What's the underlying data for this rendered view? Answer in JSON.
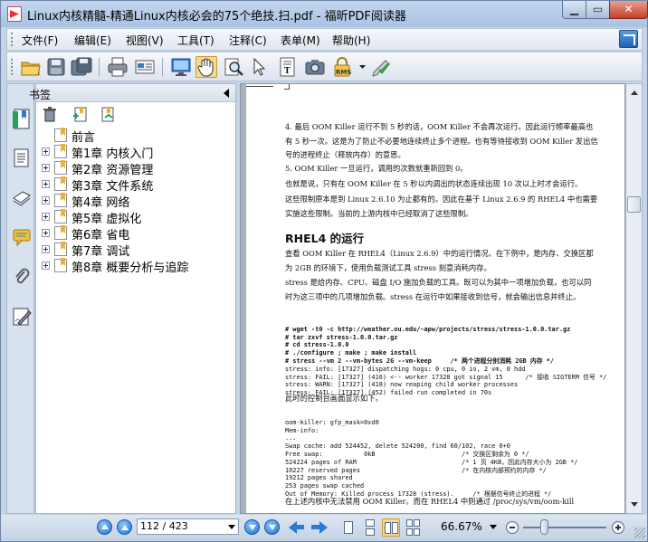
{
  "window": {
    "title": "Linux内核精髓-精通Linux内核必会的75个绝技.扫.pdf - 福昕PDF阅读器",
    "min_label": "▁",
    "max_label": "▭",
    "close_label": "✕"
  },
  "menu": {
    "items": [
      "文件(F)",
      "编辑(E)",
      "视图(V)",
      "工具(T)",
      "注释(C)",
      "表单(M)",
      "帮助(H)"
    ]
  },
  "toolbar": {
    "icons": [
      "open-folder-icon",
      "save-icon",
      "save-as-icon",
      "print-icon",
      "email-icon",
      "fullscreen-icon",
      "hand-icon",
      "zoom-icon",
      "select-icon",
      "typewriter-icon",
      "snapshot-icon",
      "rms-icon",
      "sign-icon"
    ],
    "rms_label": "RMS"
  },
  "bookmarks": {
    "header": "书签",
    "items": [
      {
        "label": "前言",
        "expandable": false
      },
      {
        "label": "第1章 内核入门",
        "expandable": true
      },
      {
        "label": "第2章 资源管理",
        "expandable": true
      },
      {
        "label": "第3章 文件系统",
        "expandable": true
      },
      {
        "label": "第4章 网络",
        "expandable": true
      },
      {
        "label": "第5章 虚拟化",
        "expandable": true
      },
      {
        "label": "第6章 省电",
        "expandable": true
      },
      {
        "label": "第7章 调试",
        "expandable": true
      },
      {
        "label": "第8章 概要分析与追踪",
        "expandable": true
      }
    ]
  },
  "document": {
    "p1": "4. 最后 OOM Killer 运行不到 5 秒的话，OOM Killer 不会再次运行。因此运行频率最高也有 5 秒一次。这是为了防止不必要地连续终止多个进程。也有等待接收到 OOM Killer 发出信号的进程终止（释放内存）的意思。",
    "p2": "5. OOM Killer 一旦运行，调用的次数就重新回到 0。",
    "p3": "也就是说，只有在 OOM Killer 在 5 秒以内调出的状态连续出现 10 次以上时才会运行。",
    "p4": "这些限制原本是到 Linux 2.6.10 为止都有的。因此在基于 Linux 2.6.9 的 RHEL4 中也需要实施这些限制。当前的上游内核中已经取消了这些限制。",
    "heading": "RHEL4 的运行",
    "p5": "查看 OOM Killer 在 RHEL4（Linux 2.6.9）中的运行情况。在下例中，是内存、交换区都为 2GB 的环境下，使用负载测试工具 stress 刻意消耗内存。",
    "p6": "stress 是给内存、CPU、磁盘 I/O 施加负载的工具。既可以为其中一项增加负载，也可以同时为这三项中的几项增加负载。stress 在运行中如果接收到信号，就会输出信息并终止。",
    "code1": [
      "# wget -t0 -c http://weather.ou.edu/~apw/projects/stress/stress-1.0.0.tar.gz",
      "# tar zxvf stress-1.0.0.tar.gz",
      "# cd stress-1.0.0",
      "# ./configure ; make ; make install",
      "# stress --vm 2 --vm-bytes 2G --vm-keep     /* 两个进程分别消耗 2GB 内存 */",
      "stress: info: [17327] dispatching hogs: 0 cpu, 0 io, 2 vm, 0 hdd",
      "stress: FAIL: [17327] (416) <-- worker 17328 got signal 15      /* 接收 SIGTERM 信号 */",
      "stress: WARN: [17327] (418) now reaping child worker processes",
      "stress: FAIL: [17327] (452) failed run completed in 70s"
    ],
    "p7": "此时的控制台画面显示如下。",
    "code2": [
      "oom-killer: gfp_mask=0xd0",
      "Mem-info:",
      "...",
      "Swap cache: add 524452, delete 524200, find 60/102, race 0+0",
      "Free swap:           0kB                       /* 交换区剩余为 0 */",
      "524224 pages of RAM                            /* 1 页 4KB，因此内存大小为 2GB */",
      "10227 reserved pages                           /* 在内核内部预约的内存 */",
      "19212 pages shared",
      "253 pages swap cached",
      "Out of Memory: Killed process 17328 (stress).     /* 根据信号终止的进程 */"
    ],
    "p8": "在上述内核中无法禁用 OOM Killer。而在 RHEL4 中则通过 /proc/sys/vm/oom-kill"
  },
  "status": {
    "page_value": "112 / 423",
    "zoom": "66.67%",
    "zoom_level": 0.25
  },
  "colors": {
    "accent_blue": "#2d79d6",
    "active_button": "#f9d98c"
  }
}
